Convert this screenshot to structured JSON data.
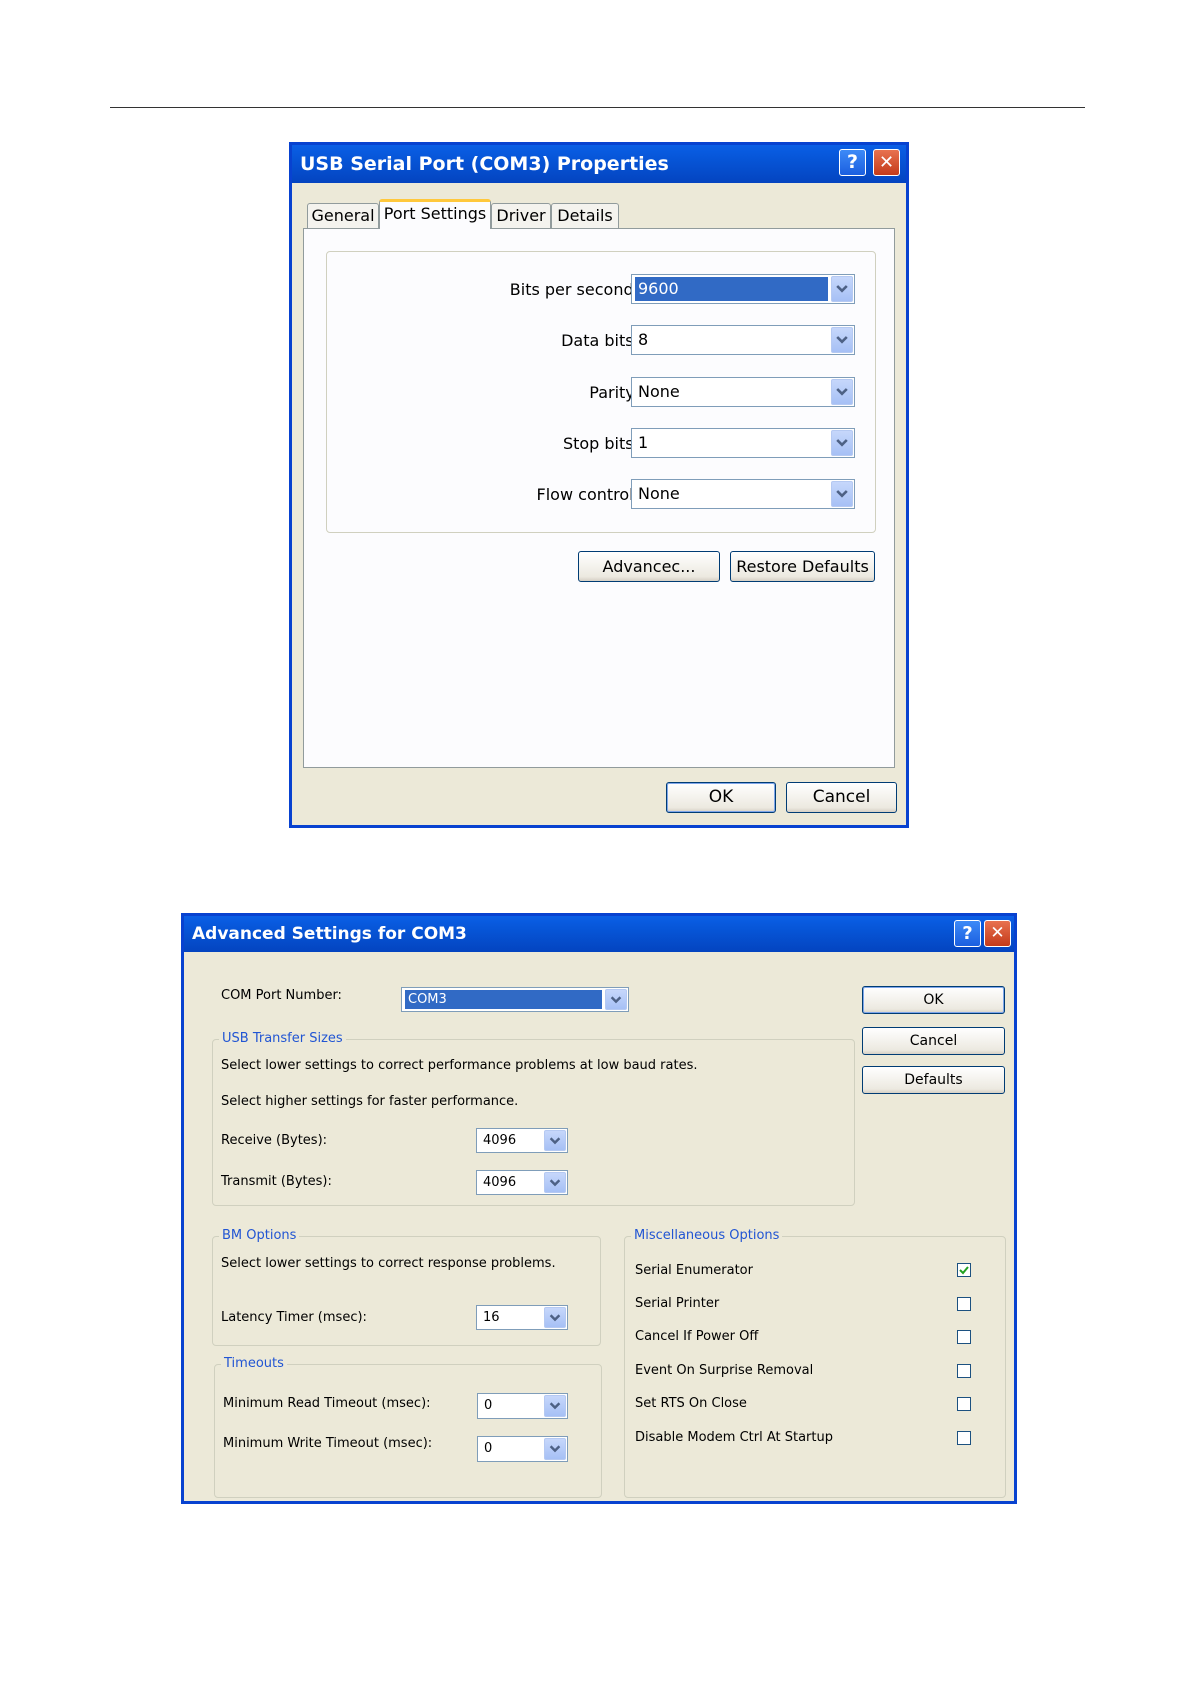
{
  "dialog1": {
    "title": "USB Serial Port (COM3) Properties",
    "tabs": [
      "General",
      "Port Settings",
      "Driver",
      "Details"
    ],
    "active_tab": "Port Settings",
    "fields": [
      {
        "label": "Bits per second:",
        "value": "9600"
      },
      {
        "label": "Data bits:",
        "value": "8"
      },
      {
        "label": "Parity:",
        "value": "None"
      },
      {
        "label": "Stop bits:",
        "value": "1"
      },
      {
        "label": "Flow control:",
        "value": "None"
      }
    ],
    "advanced_label": "Advancec...",
    "restore_label": "Restore Defaults",
    "ok_label": "OK",
    "cancel_label": "Cancel",
    "help_glyph": "?",
    "close_glyph": "✕"
  },
  "dialog2": {
    "title": "Advanced Settings for COM3",
    "com_port_label": "COM Port Number:",
    "com_port_value": "COM3",
    "ok_label": "OK",
    "cancel_label": "Cancel",
    "defaults_label": "Defaults",
    "help_glyph": "?",
    "close_glyph": "✕",
    "usb": {
      "legend": "USB Transfer Sizes",
      "line1": "Select lower settings to correct performance problems at low baud rates.",
      "line2": "Select higher settings for faster performance.",
      "receive_label": "Receive (Bytes):",
      "receive_value": "4096",
      "transmit_label": "Transmit (Bytes):",
      "transmit_value": "4096"
    },
    "bm": {
      "legend": "BM Options",
      "line1": "Select lower settings to correct response problems.",
      "latency_label": "Latency Timer (msec):",
      "latency_value": "16"
    },
    "timeouts": {
      "legend": "Timeouts",
      "read_label": "Minimum Read Timeout (msec):",
      "read_value": "0",
      "write_label": "Minimum Write Timeout (msec):",
      "write_value": "0"
    },
    "misc": {
      "legend": "Miscellaneous Options",
      "options": [
        {
          "label": "Serial Enumerator",
          "checked": true
        },
        {
          "label": "Serial Printer",
          "checked": false
        },
        {
          "label": "Cancel If Power Off",
          "checked": false
        },
        {
          "label": "Event On Surprise Removal",
          "checked": false
        },
        {
          "label": "Set RTS On Close",
          "checked": false
        },
        {
          "label": "Disable Modem Ctrl At Startup",
          "checked": false
        }
      ]
    }
  },
  "colors": {
    "xp_blue": "#0842d0",
    "dialog_bg": "#ece9d8",
    "selection": "#316ac5",
    "legend_text": "#2155d3"
  }
}
